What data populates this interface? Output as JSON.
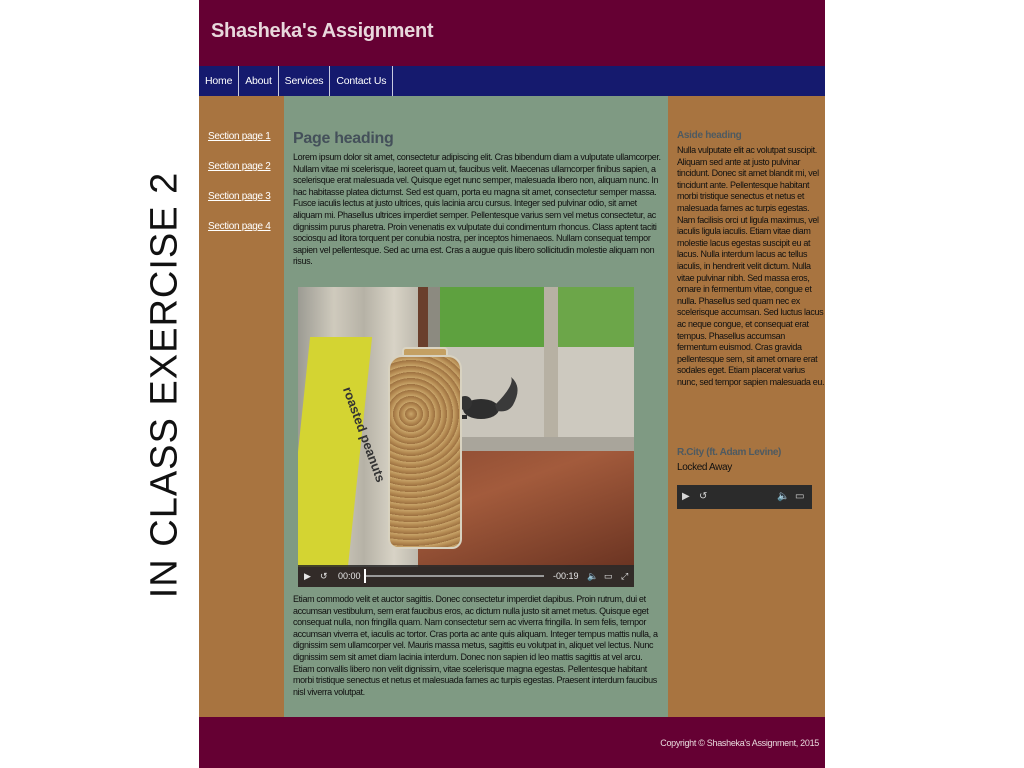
{
  "side_caption": "IN CLASS EXERCISE 2",
  "header": {
    "title": "Shasheka's Assignment"
  },
  "nav": {
    "items": [
      {
        "label": "Home"
      },
      {
        "label": "About"
      },
      {
        "label": "Services"
      },
      {
        "label": "Contact Us"
      }
    ]
  },
  "left": {
    "links": [
      {
        "label": "Section page 1"
      },
      {
        "label": "Section page 2"
      },
      {
        "label": "Section page 3"
      },
      {
        "label": "Section page 4"
      }
    ]
  },
  "main": {
    "heading": "Page heading",
    "paragraph1": "Lorem ipsum dolor sit amet, consectetur adipiscing elit. Cras bibendum diam a vulputate ullamcorper. Nullam vitae mi scelerisque, laoreet quam ut, faucibus velit. Maecenas ullamcorper finibus sapien, a scelerisque erat malesuada vel. Quisque eget nunc semper, malesuada libero non, aliquam nunc. In hac habitasse platea dictumst. Sed est quam, porta eu magna sit amet, consectetur semper massa. Fusce iaculis lectus at justo ultrices, quis lacinia arcu cursus. Integer sed pulvinar odio, sit amet aliquam mi. Phasellus ultrices imperdiet semper. Pellentesque varius sem vel metus consectetur, ac dignissim purus pharetra. Proin venenatis ex vulputate dui condimentum rhoncus. Class aptent taciti sociosqu ad litora torquent per conubia nostra, per inceptos himenaeos. Nullam consequat tempor sapien vel pellentesque. Sed ac urna est. Cras a augue quis libero sollicitudin molestie aliquam non risus.",
    "video": {
      "bag_text": "roasted peanuts",
      "time_current": "00:00",
      "time_remaining": "-00:19"
    },
    "paragraph2": "Etiam commodo velit et auctor sagittis. Donec consectetur imperdiet dapibus. Proin rutrum, dui et accumsan vestibulum, sem erat faucibus eros, ac dictum nulla justo sit amet metus. Quisque eget consequat nulla, non fringilla quam. Nam consectetur sem ac viverra fringilla. In sem felis, tempor accumsan viverra et, iaculis ac tortor. Cras porta ac ante quis aliquam. Integer tempus mattis nulla, a dignissim sem ullamcorper vel. Mauris massa metus, sagittis eu volutpat in, aliquet vel lectus. Nunc dignissim sem sit amet diam lacinia interdum. Donec non sapien id leo mattis sagittis at vel arcu. Etiam convallis libero non velit dignissim, vitae scelerisque magna egestas. Pellentesque habitant morbi tristique senectus et netus et malesuada fames ac turpis egestas. Praesent interdum faucibus nisl viverra volutpat."
  },
  "aside": {
    "heading": "Aside heading",
    "paragraph": "Nulla vulputate elit ac volutpat suscipit. Aliquam sed ante at justo pulvinar tincidunt. Donec sit amet blandit mi, vel tincidunt ante. Pellentesque habitant morbi tristique senectus et netus et malesuada fames ac turpis egestas. Nam facilisis orci ut ligula maximus, vel iaculis ligula iaculis. Etiam vitae diam molestie lacus egestas suscipit eu at lacus. Nulla interdum lacus ac tellus iaculis, in hendrerit velit dictum. Nulla vitae pulvinar nibh. Sed massa eros, ornare in fermentum vitae, congue et nulla. Phasellus sed quam nec ex scelerisque accumsan. Sed luctus lacus ac neque congue, et consequat erat tempus. Phasellus accumsan fermentum euismod. Cras gravida pellentesque sem, sit amet ornare erat sodales eget. Etiam placerat varius nunc, sed tempor sapien malesuada eu.",
    "song_title": "R.City (ft. Adam Levine)",
    "song_name": "Locked Away"
  },
  "footer": {
    "copyright": "Copyright © Shasheka's Assignment, 2015"
  },
  "icons": {
    "play": "play-icon",
    "skip_back": "skip-back-icon",
    "volume": "volume-icon",
    "airplay": "airplay-icon",
    "fullscreen": "fullscreen-icon"
  },
  "colors": {
    "header_bg": "#650033",
    "nav_bg": "#151a6e",
    "sidebar_bg": "#a87440",
    "main_bg": "#7f9a83",
    "footer_bg": "#650033"
  }
}
